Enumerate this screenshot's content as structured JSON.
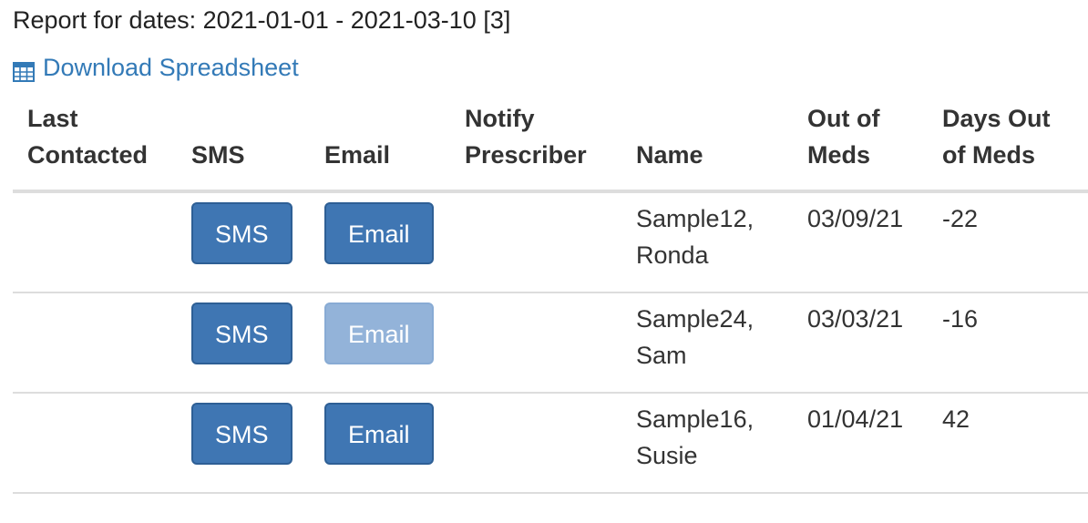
{
  "report": {
    "title": "Report for dates: 2021-01-01 - 2021-03-10 [3]"
  },
  "download": {
    "label": "Download Spreadsheet",
    "icon": "table-icon",
    "color": "#337ab7"
  },
  "table": {
    "headers": {
      "last_contacted": "Last Contacted",
      "sms": "SMS",
      "email": "Email",
      "notify_prescriber": "Notify Prescriber",
      "name": "Name",
      "out_of_meds": "Out of Meds",
      "days_out_of_meds": "Days Out of Meds"
    },
    "rows": [
      {
        "last_contacted": "",
        "sms_label": "SMS",
        "email_label": "Email",
        "email_enabled": true,
        "notify_prescriber": "",
        "name_line1": "Sample12,",
        "name_line2": "Ronda",
        "out_of_meds": "03/09/21",
        "days_out_of_meds": "-22"
      },
      {
        "last_contacted": "",
        "sms_label": "SMS",
        "email_label": "Email",
        "email_enabled": false,
        "notify_prescriber": "",
        "name_line1": "Sample24,",
        "name_line2": "Sam",
        "out_of_meds": "03/03/21",
        "days_out_of_meds": "-16"
      },
      {
        "last_contacted": "",
        "sms_label": "SMS",
        "email_label": "Email",
        "email_enabled": true,
        "notify_prescriber": "",
        "name_line1": "Sample16,",
        "name_line2": "Susie",
        "out_of_meds": "01/04/21",
        "days_out_of_meds": "42"
      }
    ]
  },
  "colors": {
    "button_primary": "#3f76b3",
    "button_disabled": "#93b3d9",
    "link": "#337ab7"
  }
}
